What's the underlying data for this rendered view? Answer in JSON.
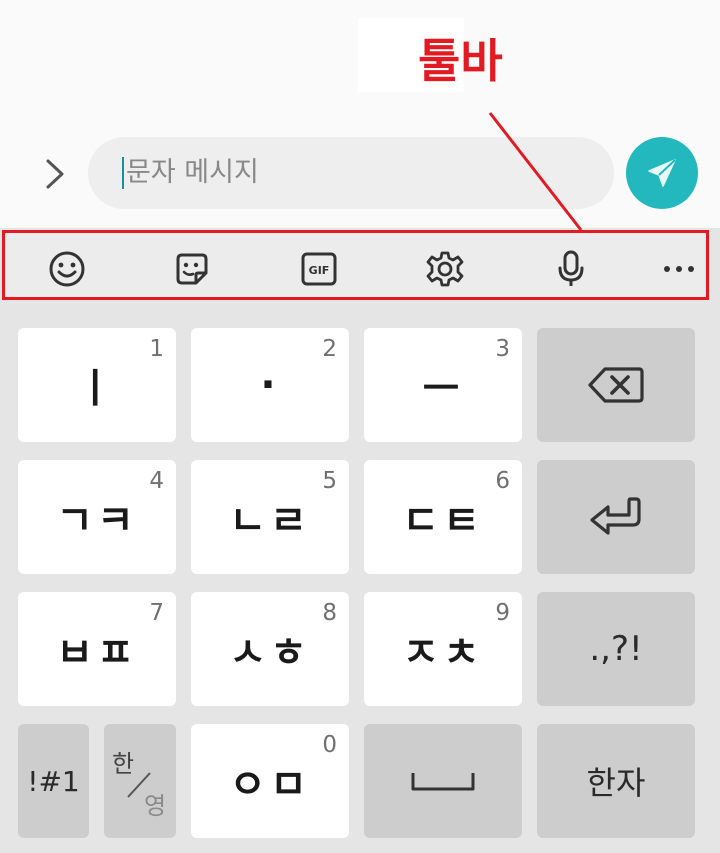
{
  "annotation": {
    "label": "툴바",
    "color": "#e21b23"
  },
  "composer": {
    "placeholder": "문자 메시지",
    "expand_icon": "chevron-right-icon",
    "send_icon": "send-icon",
    "send_color": "#22b8be"
  },
  "toolbar": {
    "items": [
      {
        "name": "emoji",
        "icon": "smiley-icon"
      },
      {
        "name": "sticker",
        "icon": "sticker-icon"
      },
      {
        "name": "gif",
        "icon": "gif-icon",
        "label": "GIF"
      },
      {
        "name": "settings",
        "icon": "gear-icon"
      },
      {
        "name": "voice",
        "icon": "microphone-icon"
      },
      {
        "name": "more",
        "icon": "more-icon"
      }
    ]
  },
  "keyboard": {
    "rows": [
      [
        {
          "label": "ㅣ",
          "number": "1"
        },
        {
          "label": "·",
          "number": "2"
        },
        {
          "label": "ㅡ",
          "number": "3"
        },
        {
          "icon": "backspace-icon"
        }
      ],
      [
        {
          "label": "ㄱㅋ",
          "number": "4"
        },
        {
          "label": "ㄴㄹ",
          "number": "5"
        },
        {
          "label": "ㄷㅌ",
          "number": "6"
        },
        {
          "icon": "enter-icon"
        }
      ],
      [
        {
          "label": "ㅂㅍ",
          "number": "7"
        },
        {
          "label": "ㅅㅎ",
          "number": "8"
        },
        {
          "label": "ㅈㅊ",
          "number": "9"
        },
        {
          "label": ".,?!"
        }
      ],
      [
        {
          "label": "!#1"
        },
        {
          "top": "한",
          "bottom": "영"
        },
        {
          "label": "ㅇㅁ",
          "number": "0"
        },
        {
          "icon": "space-icon"
        },
        {
          "label": "한자"
        }
      ]
    ]
  }
}
